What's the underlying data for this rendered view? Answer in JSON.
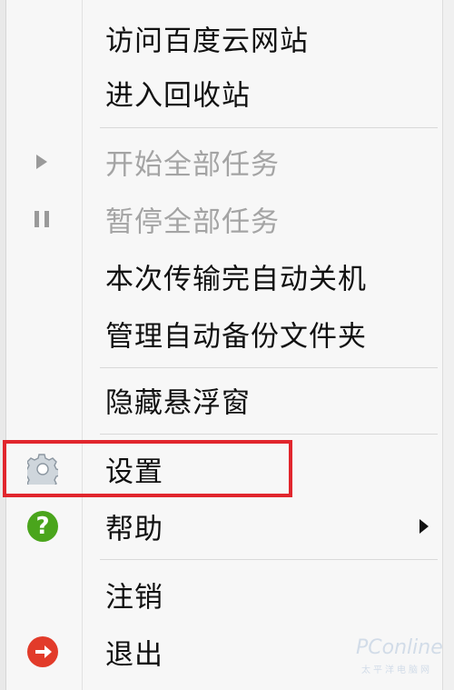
{
  "menu": {
    "items": [
      {
        "label": "访问百度云网站"
      },
      {
        "label": "进入回收站"
      },
      {
        "label": "开始全部任务",
        "icon": "play-icon",
        "disabled": true
      },
      {
        "label": "暂停全部任务",
        "icon": "pause-icon",
        "disabled": true
      },
      {
        "label": "本次传输完自动关机"
      },
      {
        "label": "管理自动备份文件夹"
      },
      {
        "label": "隐藏悬浮窗"
      },
      {
        "label": "设置",
        "icon": "gear-icon",
        "highlighted": true
      },
      {
        "label": "帮助",
        "icon": "help-icon",
        "submenu": true
      },
      {
        "label": "注销"
      },
      {
        "label": "退出",
        "icon": "exit-icon"
      }
    ]
  },
  "icons": {
    "help_glyph": "?"
  },
  "watermark": {
    "text": "PConline",
    "sub": "太平洋电脑网"
  },
  "colors": {
    "highlight": "#e1262d",
    "help": "#4aa51c",
    "exit": "#e23b2a",
    "disabled_text": "#a4a4a4"
  }
}
